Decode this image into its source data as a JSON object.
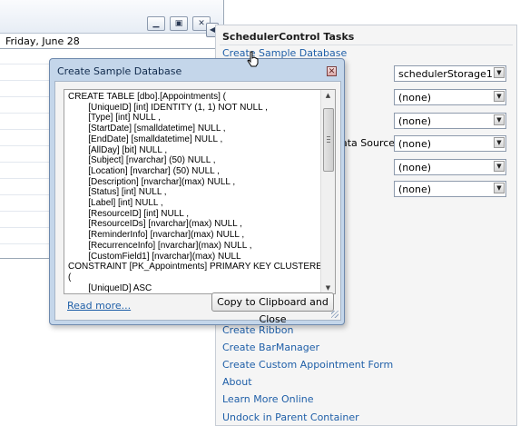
{
  "scheduler": {
    "date_header": "Friday, June 28"
  },
  "tasks_panel": {
    "title": "SchedulerControl Tasks",
    "links": {
      "create_sample_db": "Create Sample Database",
      "create_ribbon": "Create Ribbon",
      "create_barmanager": "Create BarManager",
      "create_custom_form": "Create Custom Appointment Form",
      "about": "About",
      "learn_more": "Learn More Online",
      "undock": "Undock in Parent Container"
    },
    "partial_label": "ata Source",
    "combos": [
      {
        "value": "schedulerStorage1"
      },
      {
        "value": "(none)"
      },
      {
        "value": "(none)"
      },
      {
        "value": "(none)"
      },
      {
        "value": "(none)"
      },
      {
        "value": "(none)"
      }
    ]
  },
  "dialog": {
    "title": "Create Sample Database",
    "close_glyph": "✕",
    "sql": "CREATE TABLE [dbo].[Appointments] (\n        [UniqueID] [int] IDENTITY (1, 1) NOT NULL ,\n        [Type] [int] NULL ,\n        [StartDate] [smalldatetime] NULL ,\n        [EndDate] [smalldatetime] NULL ,\n        [AllDay] [bit] NULL ,\n        [Subject] [nvarchar] (50) NULL ,\n        [Location] [nvarchar] (50) NULL ,\n        [Description] [nvarchar](max) NULL ,\n        [Status] [int] NULL ,\n        [Label] [int] NULL ,\n        [ResourceID] [int] NULL ,\n        [ResourceIDs] [nvarchar](max) NULL ,\n        [ReminderInfo] [nvarchar](max) NULL ,\n        [RecurrenceInfo] [nvarchar](max) NULL ,\n        [CustomField1] [nvarchar](max) NULL\nCONSTRAINT [PK_Appointments] PRIMARY KEY CLUSTERED\n(\n        [UniqueID] ASC\n)",
    "read_more": "Read more...",
    "copy_button": "Copy to Clipboard and Close"
  },
  "icons": {
    "minimize": "minimize-icon",
    "restore": "restore-icon",
    "close": "close-icon",
    "smart_tag": "smart-tag-arrow-icon",
    "dropdown": "chevron-down-icon",
    "cursor": "hand-cursor-icon"
  }
}
